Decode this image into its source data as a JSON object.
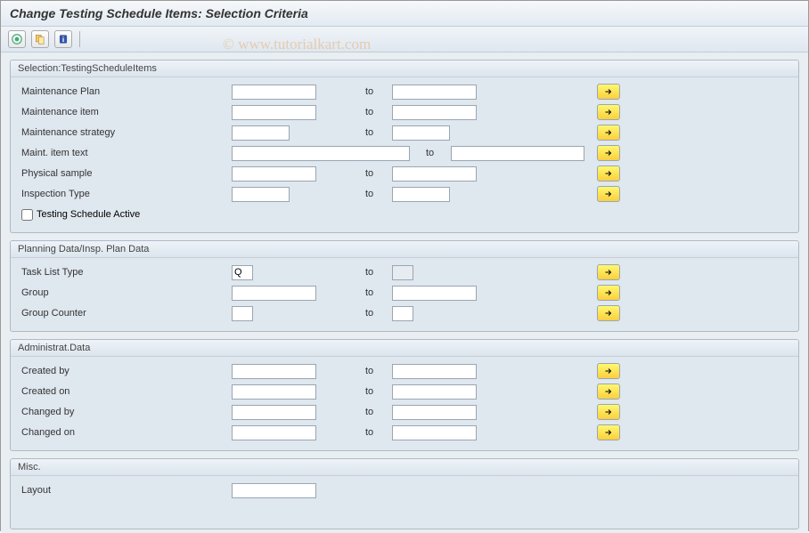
{
  "title": "Change Testing Schedule Items: Selection Criteria",
  "watermark": "© www.tutorialkart.com",
  "toolbar": {
    "execute": "Execute",
    "variant": "Get Variant",
    "info": "Information"
  },
  "labels": {
    "to": "to"
  },
  "groups": {
    "selection": {
      "title": "Selection:TestingScheduleItems",
      "fields": {
        "maint_plan": "Maintenance Plan",
        "maint_item": "Maintenance item",
        "maint_strategy": "Maintenance strategy",
        "maint_item_text": "Maint. item text",
        "physical_sample": "Physical sample",
        "inspection_type": "Inspection Type",
        "testing_active": "Testing Schedule Active"
      }
    },
    "planning": {
      "title": "Planning Data/Insp. Plan Data",
      "fields": {
        "task_list_type": "Task List Type",
        "task_list_type_value": "Q",
        "group": "Group",
        "group_counter": "Group Counter"
      }
    },
    "admin": {
      "title": "Administrat.Data",
      "fields": {
        "created_by": "Created by",
        "created_on": "Created on",
        "changed_by": "Changed by",
        "changed_on": "Changed on"
      }
    },
    "misc": {
      "title": "Misc.",
      "fields": {
        "layout": "Layout"
      }
    }
  }
}
